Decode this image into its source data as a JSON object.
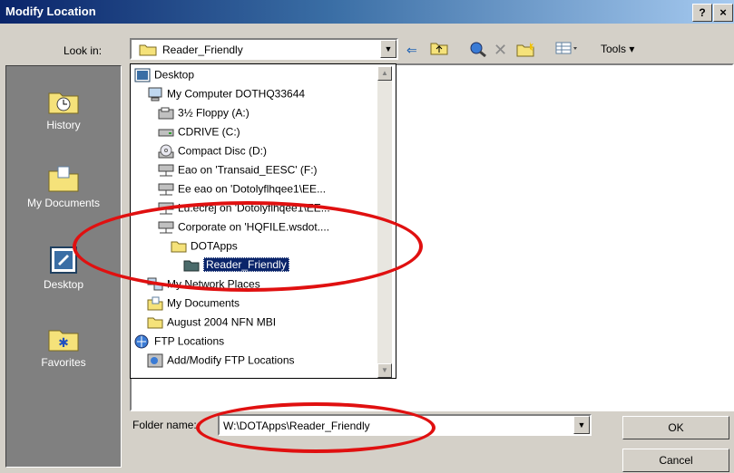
{
  "window": {
    "title": "Modify Location",
    "help": "?",
    "close": "×"
  },
  "toolbar": {
    "lookin_label": "Look in:",
    "lookin_value": "Reader_Friendly",
    "tools_label": "Tools ▾",
    "icons": [
      "back-icon",
      "up-folder-icon",
      "search-web-icon",
      "delete-icon",
      "new-folder-icon",
      "views-icon"
    ]
  },
  "places": [
    {
      "label": "History",
      "icon": "history-icon"
    },
    {
      "label": "My Documents",
      "icon": "my-documents-icon"
    },
    {
      "label": "Desktop",
      "icon": "desktop-icon"
    },
    {
      "label": "Favorites",
      "icon": "favorites-icon"
    }
  ],
  "dropdown": {
    "items": [
      {
        "label": "Desktop",
        "icon": "desktop-icon"
      },
      {
        "label": "My Computer DOTHQ33644",
        "icon": "computer-icon"
      },
      {
        "label": "3½ Floppy (A:)",
        "icon": "floppy-icon"
      },
      {
        "label": "CDRIVE (C:)",
        "icon": "drive-icon"
      },
      {
        "label": "Compact Disc (D:)",
        "icon": "cd-icon"
      },
      {
        "label": "Eao on 'Transaid_EESC' (F:)",
        "icon": "network-drive-icon"
      },
      {
        "label": "Ee eao on 'Dotolyflhqee1\\EE...",
        "icon": "network-drive-icon"
      },
      {
        "label": "Lu.ecrej on 'Dotolyflhqee1\\EE...",
        "icon": "network-drive-icon"
      },
      {
        "label": "Corporate on 'HQFILE.wsdot....",
        "icon": "network-drive-icon"
      },
      {
        "label": "DOTApps",
        "icon": "folder-icon"
      },
      {
        "label": "Reader_Friendly",
        "icon": "open-folder-icon"
      },
      {
        "label": "My Network Places",
        "icon": "network-places-icon"
      },
      {
        "label": "My Documents",
        "icon": "my-documents-icon"
      },
      {
        "label": "August 2004 NFN MBI",
        "icon": "folder-icon"
      },
      {
        "label": "FTP Locations",
        "icon": "ftp-icon"
      },
      {
        "label": "Add/Modify FTP Locations",
        "icon": "ftp-add-icon"
      }
    ]
  },
  "footer": {
    "filename_label": "Folder name:",
    "filename_value": "W:\\DOTApps\\Reader_Friendly",
    "ok_label": "OK",
    "cancel_label": "Cancel"
  },
  "colors": {
    "title_start": "#0a246a",
    "title_end": "#a6caf0",
    "annotation": "#e01010",
    "selection": "#0a246a"
  }
}
